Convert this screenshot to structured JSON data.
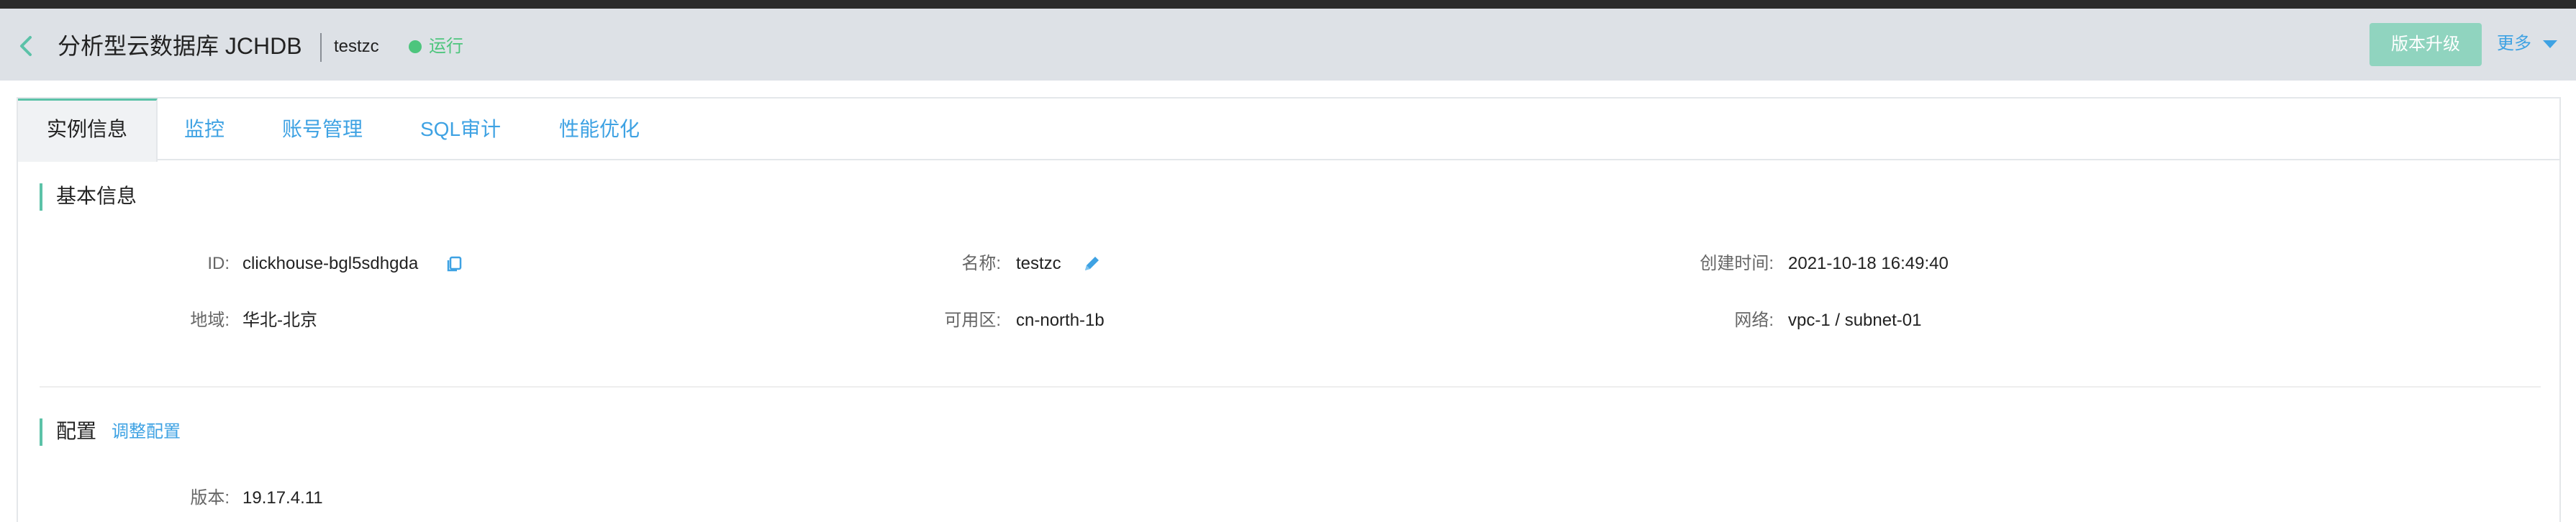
{
  "header": {
    "title": "分析型云数据库 JCHDB",
    "instance_name": "testzc",
    "status": "运行",
    "upgrade_label": "版本升级",
    "more_label": "更多"
  },
  "tabs": [
    {
      "label": "实例信息",
      "active": true
    },
    {
      "label": "监控"
    },
    {
      "label": "账号管理"
    },
    {
      "label": "SQL审计"
    },
    {
      "label": "性能优化"
    }
  ],
  "basic_info": {
    "title": "基本信息",
    "id_label": "ID:",
    "id_value": "clickhouse-bgl5sdhgda",
    "name_label": "名称:",
    "name_value": "testzc",
    "created_label": "创建时间:",
    "created_value": "2021-10-18 16:49:40",
    "region_label": "地域:",
    "region_value": "华北-北京",
    "az_label": "可用区:",
    "az_value": "cn-north-1b",
    "network_label": "网络:",
    "network_value": "vpc-1 / subnet-01"
  },
  "config": {
    "title": "配置",
    "adjust_label": "调整配置",
    "version_label": "版本:",
    "version_value": "19.17.4.11"
  },
  "colors": {
    "accent_green": "#5cc2a8",
    "link_blue": "#3ea2e3",
    "status_green": "#4dc57d",
    "header_bg": "#dde1e6",
    "button_bg": "#90d4bf"
  },
  "icons": {
    "back": "chevron-left-icon",
    "copy": "copy-icon",
    "edit": "pencil-icon",
    "more": "caret-down-icon"
  }
}
